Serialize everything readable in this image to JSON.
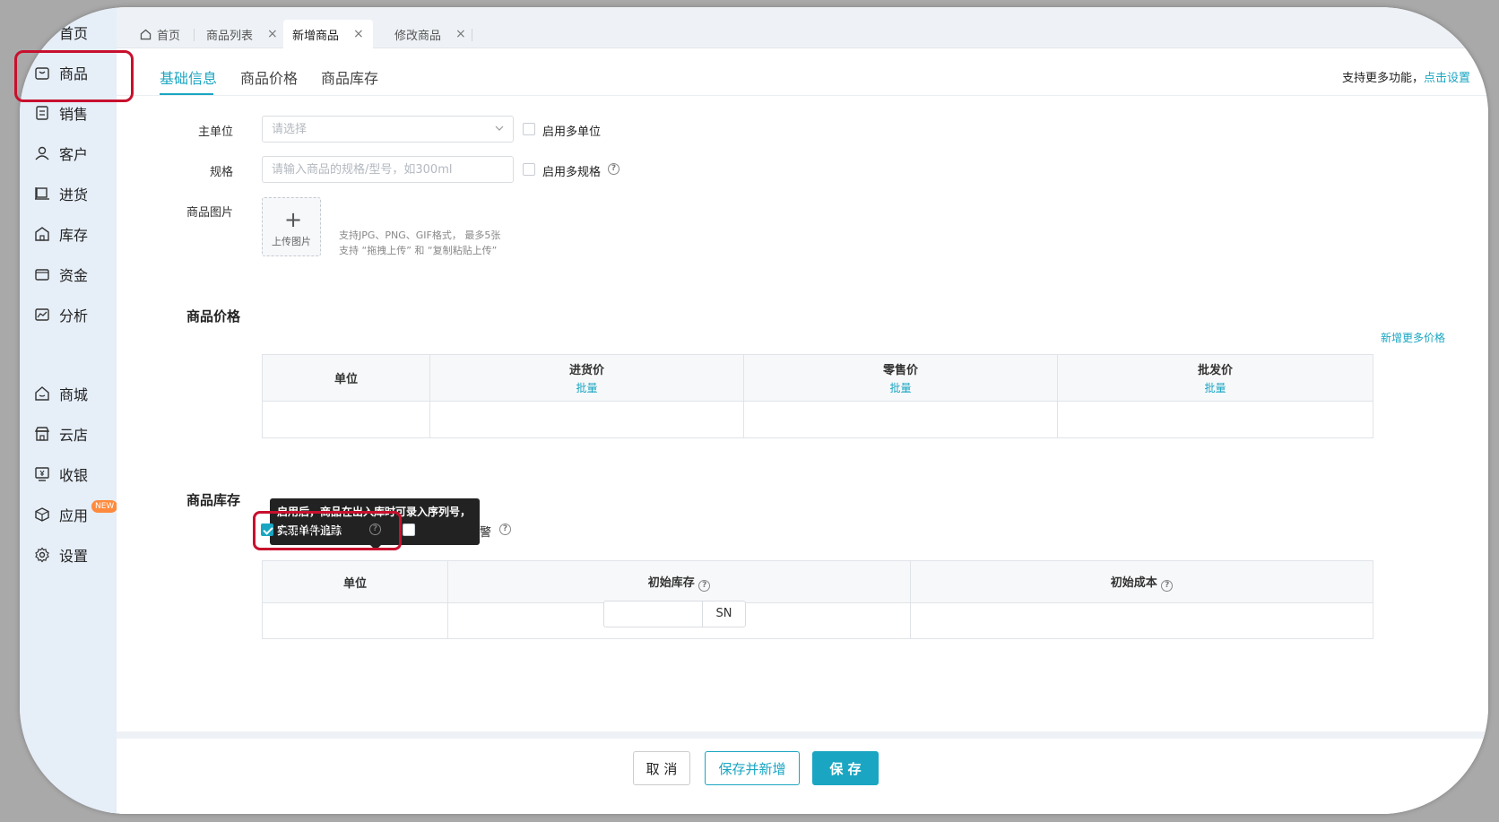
{
  "sidebar": {
    "items": [
      {
        "label": "首页",
        "icon": "home-icon"
      },
      {
        "label": "商品",
        "icon": "bag-icon"
      },
      {
        "label": "销售",
        "icon": "clipboard-icon"
      },
      {
        "label": "客户",
        "icon": "user-icon"
      },
      {
        "label": "进货",
        "icon": "cart-icon"
      },
      {
        "label": "库存",
        "icon": "warehouse-icon"
      },
      {
        "label": "资金",
        "icon": "wallet-icon"
      },
      {
        "label": "分析",
        "icon": "chart-icon"
      },
      {
        "label": "商城",
        "icon": "store-icon"
      },
      {
        "label": "云店",
        "icon": "shop-icon"
      },
      {
        "label": "收银",
        "icon": "cash-register-icon"
      },
      {
        "label": "应用",
        "icon": "cube-icon",
        "badge": "NEW"
      },
      {
        "label": "设置",
        "icon": "gear-icon"
      }
    ]
  },
  "tabs": [
    {
      "label": "首页",
      "icon": "home-icon"
    },
    {
      "label": "商品列表",
      "close": "×"
    },
    {
      "label": "新增商品",
      "close": "×",
      "active": true
    },
    {
      "label": "修改商品",
      "close": "×"
    }
  ],
  "subtabs": [
    "基础信息",
    "商品价格",
    "商品库存"
  ],
  "more_functions": {
    "text": "支持更多功能，",
    "link": "点击设置"
  },
  "form": {
    "main_unit": {
      "label": "主单位",
      "placeholder": "请选择",
      "checkbox_label": "启用多单位"
    },
    "spec": {
      "label": "规格",
      "placeholder": "请输入商品的规格/型号，如300ml",
      "checkbox_label": "启用多规格"
    },
    "image": {
      "label": "商品图片",
      "upload_label": "上传图片",
      "upload_plus": "+",
      "hint1": "支持JPG、PNG、GIF格式， 最多5张",
      "hint2": "支持 “拖拽上传” 和 “复制粘贴上传”"
    }
  },
  "price_section": {
    "title": "商品价格",
    "add_more_link": "新增更多价格",
    "columns": [
      {
        "header": "单位"
      },
      {
        "header": "进货价",
        "sub": "批量"
      },
      {
        "header": "零售价",
        "sub": "批量"
      },
      {
        "header": "批发价",
        "sub": "批量"
      }
    ]
  },
  "stock_section": {
    "title": "商品库存",
    "tooltip": "启用后，商品在出入库时可录入序列号，实现单件追踪",
    "serial_checkbox": {
      "label": "启用序列号管理",
      "checked": true
    },
    "alert_checkbox": {
      "label": "启用库存预警",
      "checked": false
    },
    "columns": [
      "单位",
      "初始库存",
      "初始成本"
    ],
    "sn_button": "SN"
  },
  "help_glyph": "?",
  "footer": {
    "cancel": "取 消",
    "save_new": "保存并新增",
    "save": "保 存"
  },
  "colors": {
    "accent": "#1aa6c2",
    "highlight": "#c8102e",
    "sidebar_bg": "#e6eef8"
  }
}
